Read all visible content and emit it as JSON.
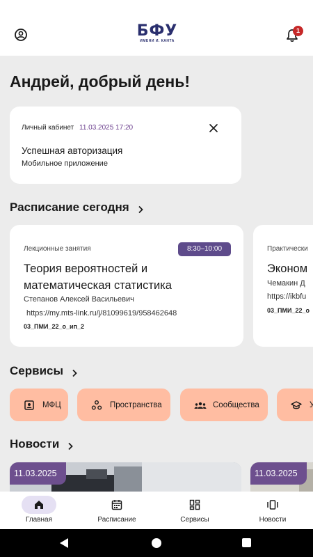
{
  "header": {
    "logo_main": "БФУ",
    "logo_sub": "ИМЕНИ И. КАНТА",
    "notification_count": "1"
  },
  "greeting": "Андрей, добрый день!",
  "login_card": {
    "label": "Личный кабинет",
    "date": "11.03.2025 17:20",
    "title": "Успешная авторизация",
    "subtitle": "Мобильное приложение"
  },
  "schedule": {
    "title": "Расписание сегодня",
    "items": [
      {
        "type": "Лекционные занятия",
        "time": "8:30–10:00",
        "subject_line1": "Теория вероятностей и",
        "subject_line2": "математическая статистика",
        "teacher": "Степанов Алексей Васильевич",
        "link": "https://my.mts-link.ru/j/81099619/958462648",
        "group": "03_ПМИ_22_о_ип_2"
      },
      {
        "type": "Практически",
        "subject_line1": "Эконом",
        "teacher": "Чемакин Д",
        "link": "https://ikbfu",
        "group": "03_ПМИ_22_о"
      }
    ]
  },
  "services": {
    "title": "Сервисы",
    "items": [
      {
        "label": "МФЦ",
        "icon": "id-badge-icon"
      },
      {
        "label": "Пространства",
        "icon": "spaces-icon"
      },
      {
        "label": "Сообщества",
        "icon": "people-icon"
      },
      {
        "label": "Уч",
        "icon": "graduation-cap-icon"
      }
    ]
  },
  "news": {
    "title": "Новости",
    "items": [
      {
        "date": "11.03.2025"
      },
      {
        "date": "11.03.2025"
      }
    ]
  },
  "bottom_nav": {
    "items": [
      {
        "label": "Главная",
        "icon": "home-icon",
        "active": true
      },
      {
        "label": "Расписание",
        "icon": "calendar-icon",
        "active": false
      },
      {
        "label": "Сервисы",
        "icon": "grid-icon",
        "active": false
      },
      {
        "label": "Новости",
        "icon": "news-icon",
        "active": false
      }
    ]
  },
  "colors": {
    "accent": "#5e4b8b",
    "service_chip": "#ffbda2",
    "badge": "#c62828",
    "background": "#ececec"
  }
}
